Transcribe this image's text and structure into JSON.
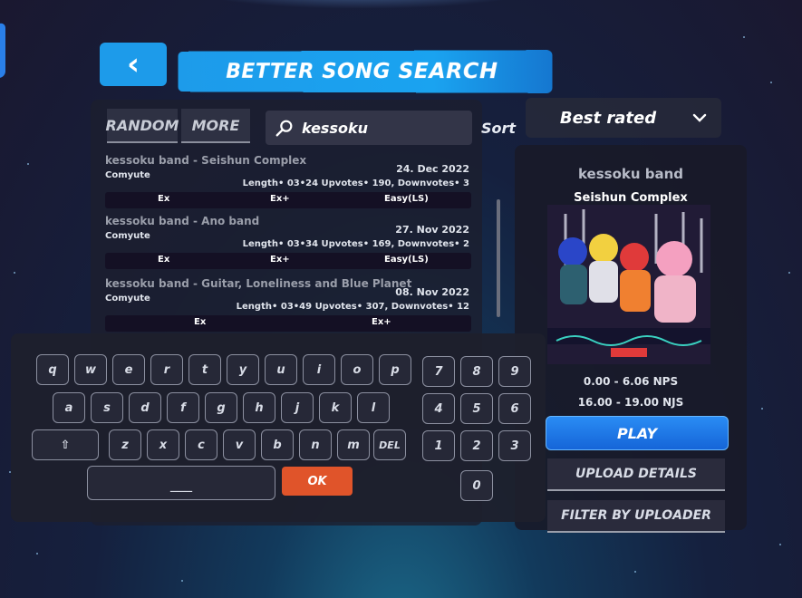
{
  "header": {
    "back_icon": "chevron-left-icon",
    "back_glyph": "‹",
    "title": "BETTER SONG SEARCH"
  },
  "tabs": {
    "random": "RANDOM",
    "more": "MORE"
  },
  "search": {
    "query": "kessoku",
    "icon": "search-icon"
  },
  "sort": {
    "label": "Sort",
    "value": "Best rated"
  },
  "songs": [
    {
      "title": "kessoku band - Seishun Complex",
      "mapper": "Comyute",
      "date": "24. Dec 2022",
      "stats": "Length• 03•24 Upvotes• 190, Downvotes• 3",
      "diffs": [
        "Ex",
        "Ex+",
        "Easy(LS)"
      ]
    },
    {
      "title": "kessoku band - Ano band",
      "mapper": "Comyute",
      "date": "27. Nov 2022",
      "stats": "Length• 03•34 Upvotes• 169, Downvotes• 2",
      "diffs": [
        "Ex",
        "Ex+",
        "Easy(LS)"
      ]
    },
    {
      "title": "kessoku band - Guitar, Loneliness and Blue Planet",
      "mapper": "Comyute",
      "date": "08. Nov 2022",
      "stats": "Length• 03•49 Upvotes• 307, Downvotes• 12",
      "diffs": [
        "Ex",
        "Ex+"
      ]
    }
  ],
  "details": {
    "artist": "kessoku band",
    "song": "Seishun Complex",
    "nps": "0.00 - 6.06 NPS",
    "njs": "16.00 - 19.00 NJS",
    "play": "PLAY",
    "upload_details": "UPLOAD DETAILS",
    "filter_by_uploader": "FILTER BY UPLOADER"
  },
  "keyboard": {
    "row1": [
      "q",
      "w",
      "e",
      "r",
      "t",
      "y",
      "u",
      "i",
      "o",
      "p"
    ],
    "row2": [
      "a",
      "s",
      "d",
      "f",
      "g",
      "h",
      "j",
      "k",
      "l"
    ],
    "shift": "⇧",
    "row3": [
      "z",
      "x",
      "c",
      "v",
      "b",
      "n",
      "m"
    ],
    "del": "DEL",
    "numpad": [
      [
        "7",
        "8",
        "9"
      ],
      [
        "4",
        "5",
        "6"
      ],
      [
        "1",
        "2",
        "3"
      ],
      [
        "0"
      ]
    ],
    "space": "___",
    "ok": "OK"
  },
  "colors": {
    "accent": "#1d9bea",
    "play": "#1f7ae8",
    "ok": "#e0542a"
  }
}
